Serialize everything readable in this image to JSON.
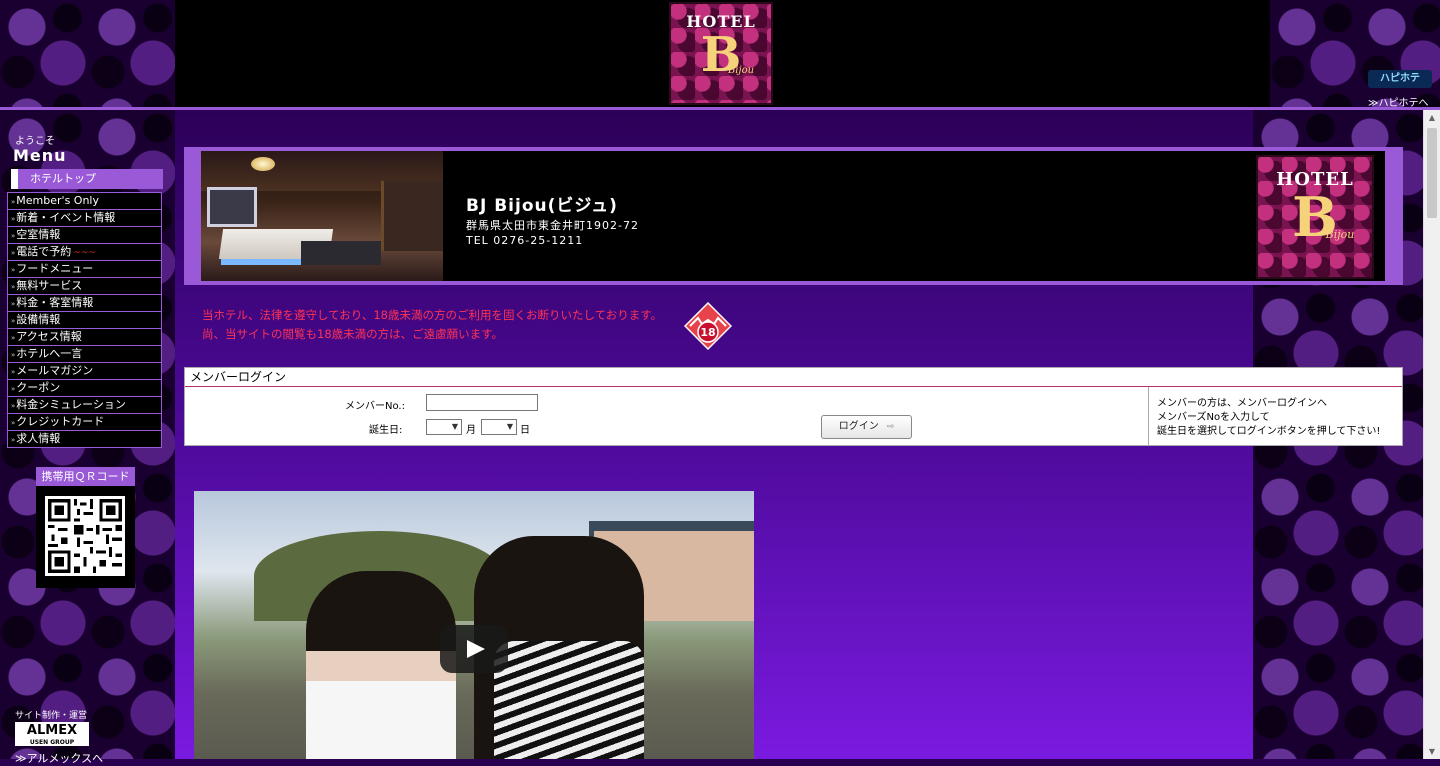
{
  "header": {
    "logo": {
      "hotel": "HOTEL",
      "mark": "B",
      "name": "Bijou"
    },
    "hapihote_badge": "ハピホテ",
    "hapihote_link": "≫ハピホテへ"
  },
  "sidebar": {
    "welcome": "ようこそ",
    "menu_title": "Menu",
    "hotel_top": "ホテルトップ",
    "items": [
      {
        "label": "Member's Only"
      },
      {
        "label": "新着・イベント情報"
      },
      {
        "label": "空室情報"
      },
      {
        "label": "電話で予約",
        "mark": "~~~"
      },
      {
        "label": "フードメニュー"
      },
      {
        "label": "無料サービス"
      },
      {
        "label": "料金・客室情報"
      },
      {
        "label": "設備情報"
      },
      {
        "label": "アクセス情報"
      },
      {
        "label": "ホテルへ一言"
      },
      {
        "label": "メールマガジン"
      },
      {
        "label": "クーポン"
      },
      {
        "label": "料金シミュレーション"
      },
      {
        "label": "クレジットカード"
      },
      {
        "label": "求人情報"
      }
    ],
    "bullet": "»",
    "qr_title": "携帯用ＱＲコード",
    "almex_caption": "サイト制作・運営",
    "almex_logo": "ALMEX",
    "almex_sub": "USEN GROUP",
    "almex_link": "≫アルメックスへ"
  },
  "banner": {
    "hotel_name": "BJ Bijou(ビジュ)",
    "address": "群馬県太田市東金井町1902-72",
    "tel": "TEL 0276-25-1211",
    "logo": {
      "hotel": "HOTEL",
      "mark": "B",
      "name": "Bijou"
    }
  },
  "notice": {
    "line1": "当ホテル、法律を遵守しており、18歳未満の方のご利用を固くお断りいたしております。",
    "line2": "尚、当サイトの閲覧も18歳未満の方は、ご遠慮願います。",
    "age_badge": "18"
  },
  "login": {
    "title": "メンバーログイン",
    "member_no_label": "メンバーNo.:",
    "member_no_value": "",
    "birthday_label": "誕生日:",
    "month_unit": "月",
    "day_unit": "日",
    "select_arrow": "▼",
    "button": "ログイン",
    "button_arrow": "⇨",
    "help_line1": "メンバーの方は、メンバーログインへ",
    "help_line2": "メンバーズNoを入力して",
    "help_line3": "誕生日を選択してログインボタンを押して下さい!"
  },
  "scrollbar": {
    "up": "▲",
    "down": "▼"
  }
}
